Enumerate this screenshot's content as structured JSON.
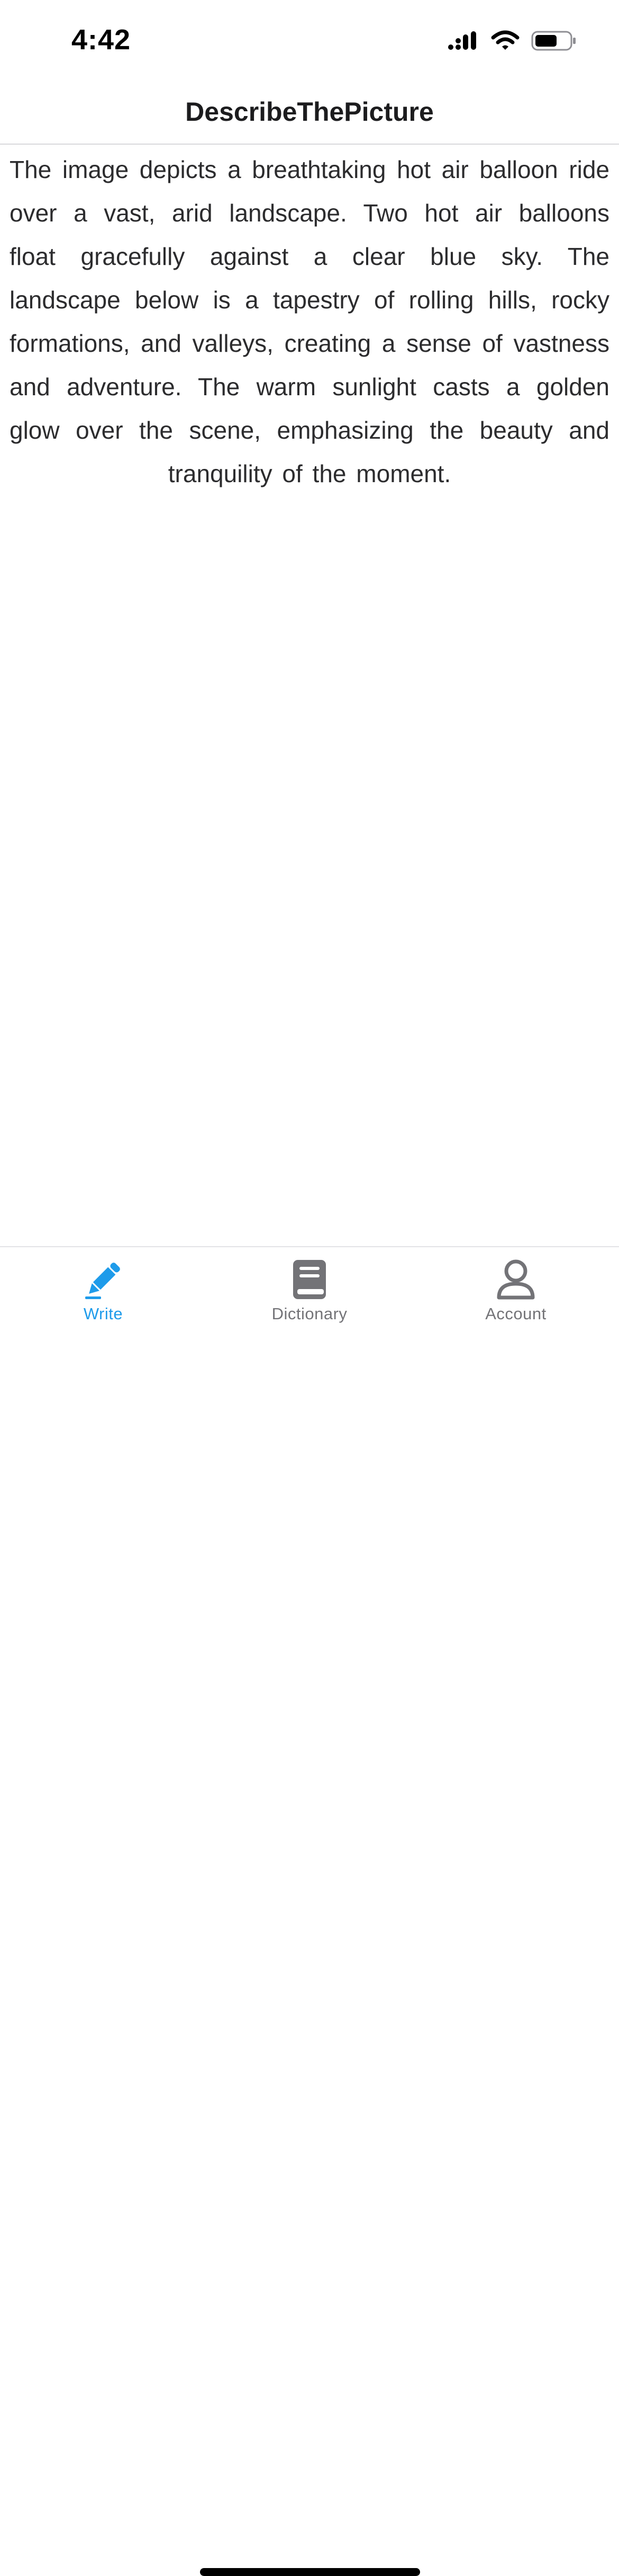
{
  "status_bar": {
    "time": "4:42",
    "icons": [
      "cellular-signal-icon",
      "wifi-icon",
      "battery-icon"
    ]
  },
  "nav": {
    "title": "DescribeThePicture"
  },
  "content": {
    "description": "The image depicts a breathtaking hot air balloon ride over a vast, arid landscape. Two hot air balloons float gracefully against a clear blue sky. The landscape below is a tapestry of rolling hills, rocky formations, and valleys, creating a sense of vastness and adventure. The warm sunlight casts a golden glow over the scene, emphasizing the beauty and tranquility of the moment."
  },
  "tab_bar": {
    "tabs": [
      {
        "label": "Write",
        "icon": "pencil-icon",
        "active": true
      },
      {
        "label": "Dictionary",
        "icon": "book-icon",
        "active": false
      },
      {
        "label": "Account",
        "icon": "person-icon",
        "active": false
      }
    ]
  },
  "colors": {
    "accent": "#1e9bea",
    "inactive": "#737377",
    "text": "#2c2c2e",
    "background": "#ffffff"
  }
}
